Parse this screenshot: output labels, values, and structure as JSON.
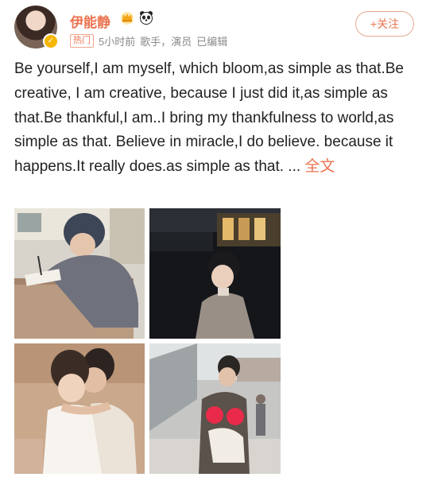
{
  "post": {
    "user_name": "伊能静",
    "hot_tag": "热门",
    "time": "5小时前",
    "roles": "歌手，演员",
    "edited": "已编辑",
    "follow_label": "+关注",
    "text": "Be yourself,I am myself, which bloom,as simple as that.Be creative, I am creative, because I just did it,as simple as that.Be thankful,I am..I bring my thankfulness to world,as simple as that. Believe in miracle,I do believe. because it happens.It really does.as simple as that.  ...",
    "more_label": "全文",
    "badges": [
      "crown-badge-icon",
      "panda-badge-icon"
    ],
    "accent_color": "#eb7350"
  }
}
